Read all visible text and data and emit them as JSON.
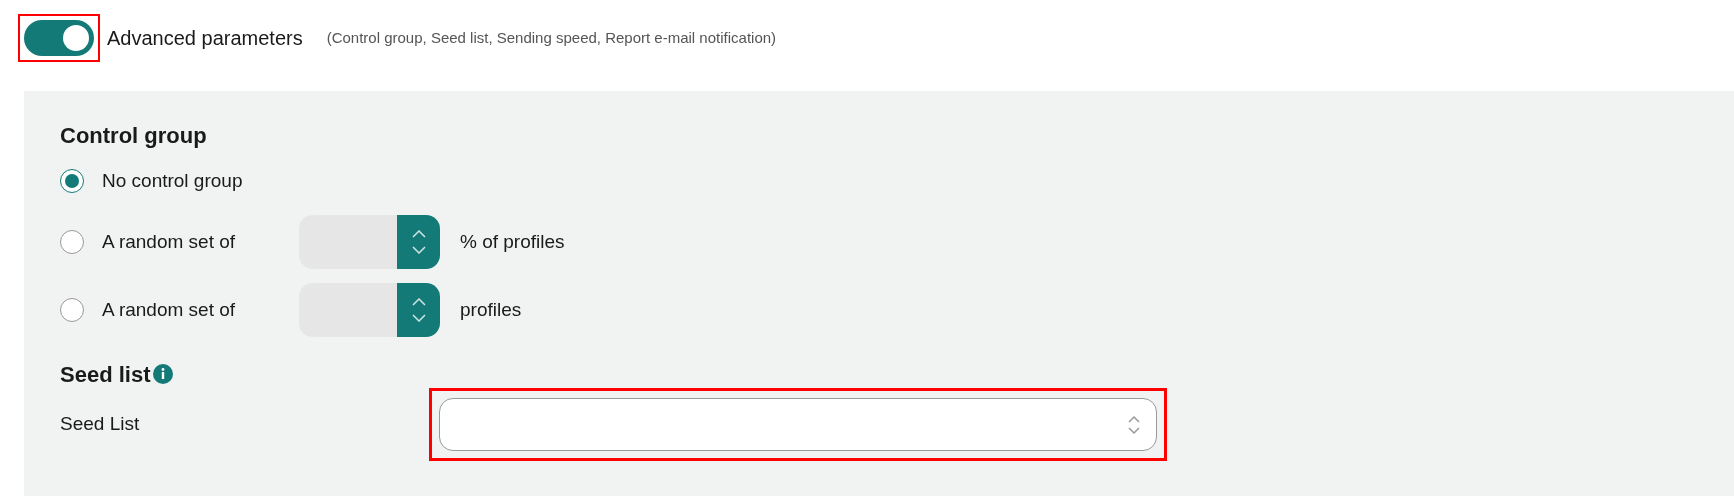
{
  "advanced_toggle": {
    "on": true,
    "highlighted": true,
    "label": "Advanced parameters",
    "hint": "(Control group, Seed list, Sending speed, Report e-mail notification)"
  },
  "control_group": {
    "title": "Control group",
    "options": [
      {
        "kind": "plain",
        "label": "No control group",
        "selected": true
      },
      {
        "kind": "spinner",
        "label": "A random set of",
        "suffix": "% of profiles",
        "selected": false
      },
      {
        "kind": "spinner",
        "label": "A random set of",
        "suffix": "profiles",
        "selected": false
      }
    ]
  },
  "seed_list": {
    "title": "Seed list",
    "field_label": "Seed List",
    "highlighted": true
  }
}
